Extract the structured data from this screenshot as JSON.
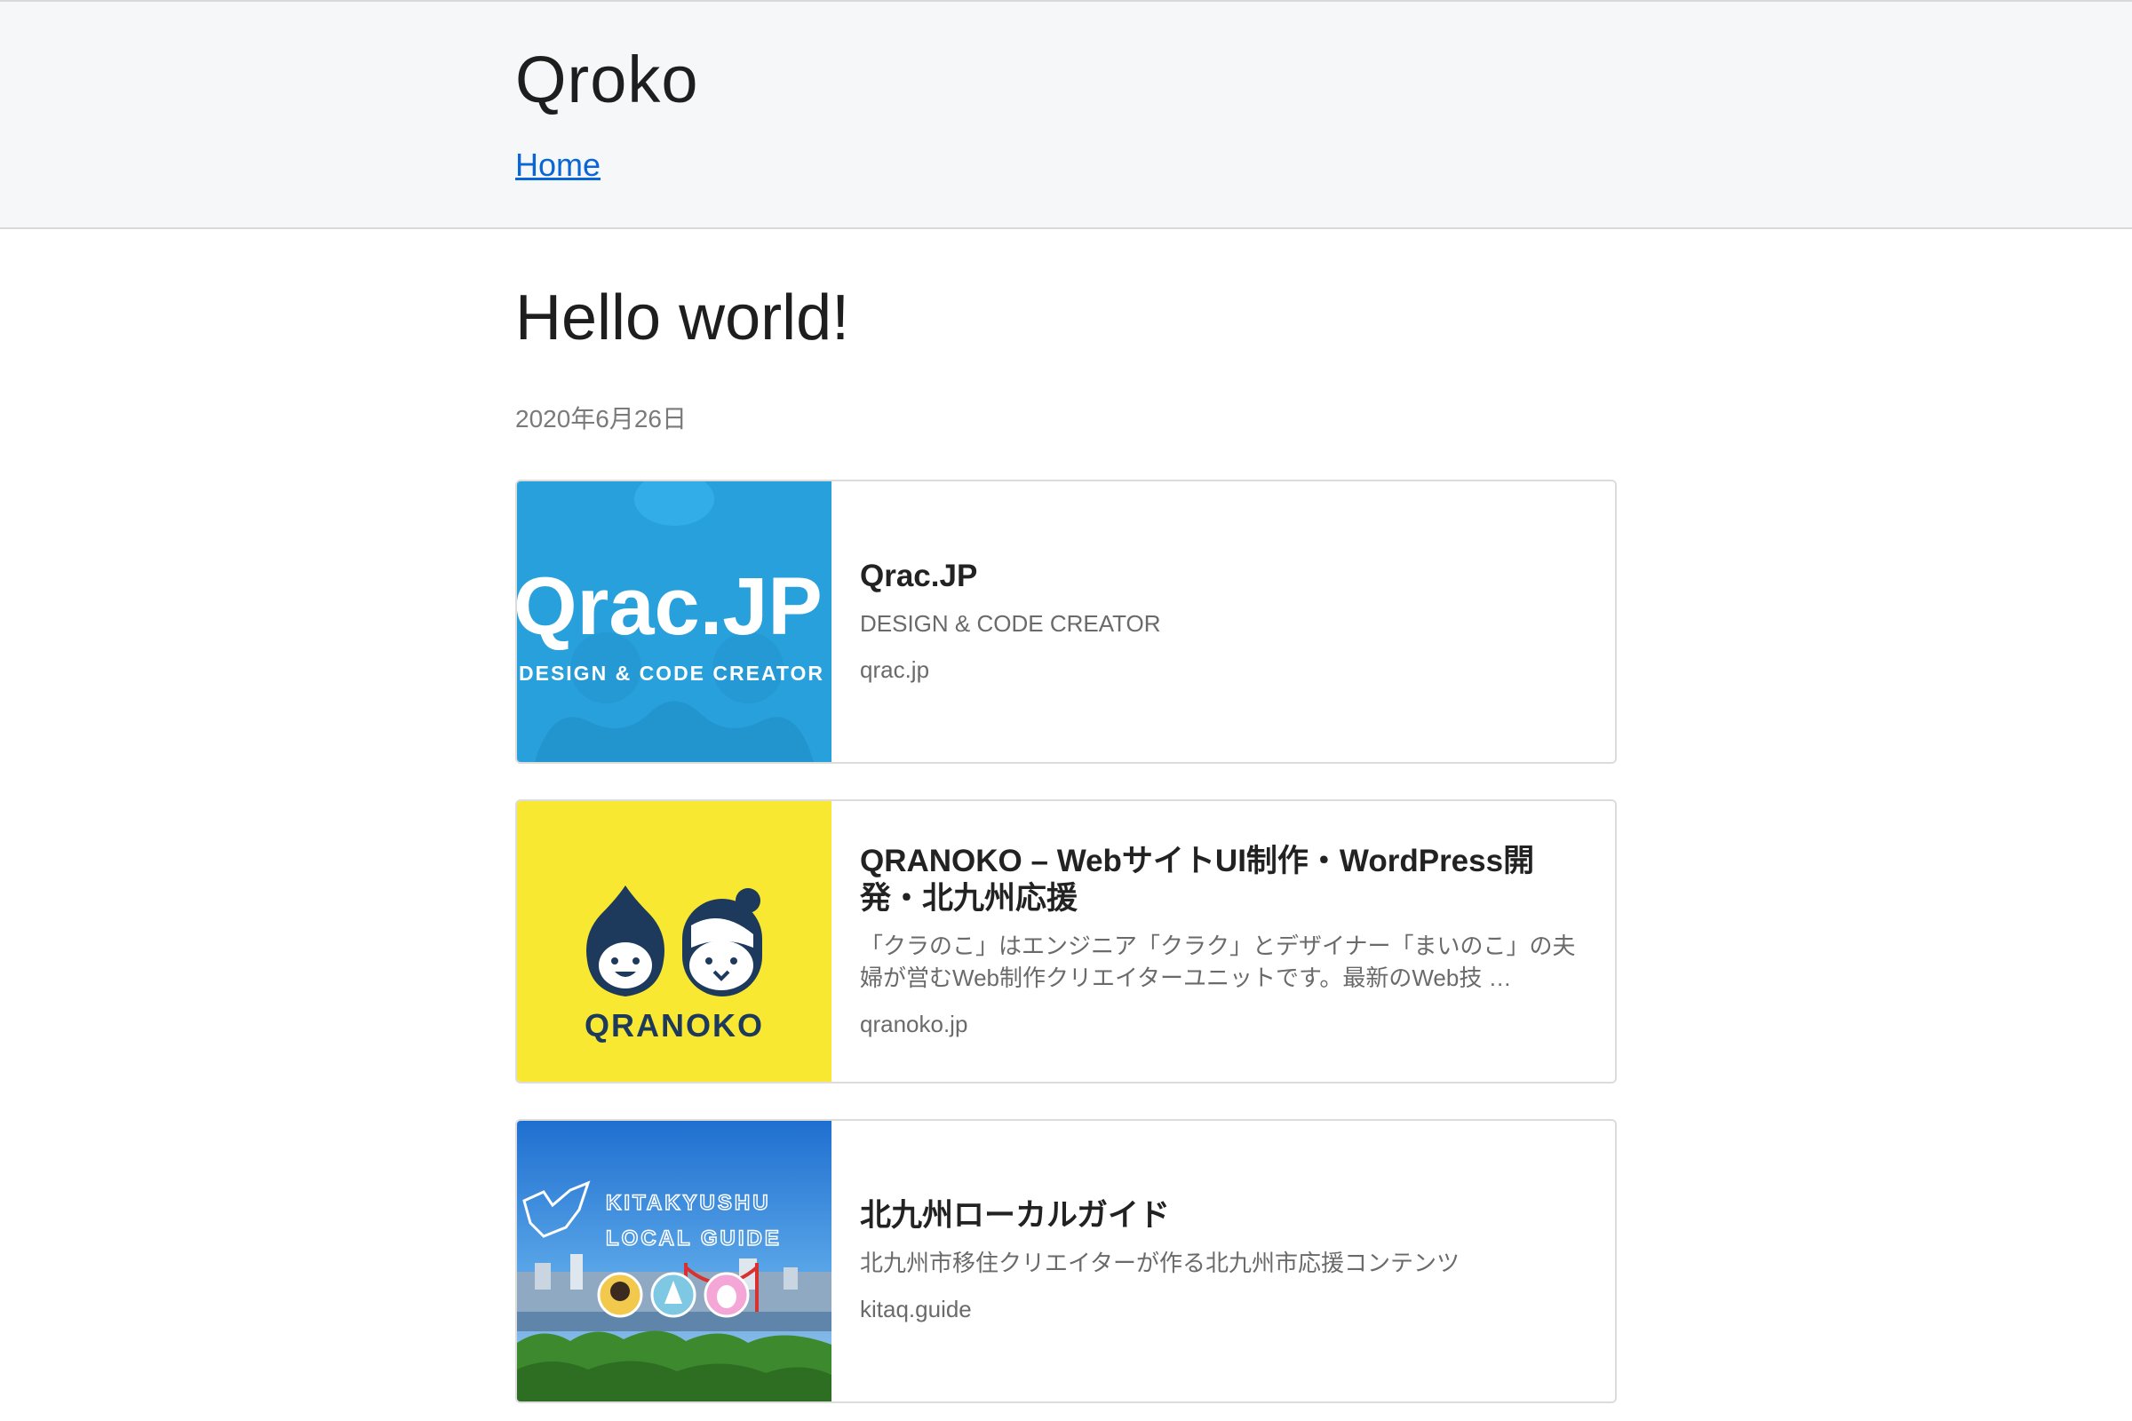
{
  "header": {
    "site_title": "Qroko",
    "nav_home": "Home"
  },
  "post": {
    "title": "Hello world!",
    "date": "2020年6月26日"
  },
  "cards": [
    {
      "title": "Qrac.JP",
      "description": "DESIGN & CODE CREATOR",
      "url": "qrac.jp",
      "thumb_logo": "Qrac.JP",
      "thumb_tagline": "DESIGN & CODE CREATOR",
      "thumb_bg": "#28a0dc"
    },
    {
      "title": "QRANOKO – WebサイトUI制作・WordPress開発・北九州応援",
      "description": "「クラのこ」はエンジニア「クラク」とデザイナー「まいのこ」の夫婦が営むWeb制作クリエイターユニットです。最新のWeb技 …",
      "url": "qranoko.jp",
      "thumb_logo": "QRANOKO",
      "thumb_bg": "#f9e832"
    },
    {
      "title": "北九州ローカルガイド",
      "description": "北九州市移住クリエイターが作る北九州市応援コンテンツ",
      "url": "kitaq.guide",
      "thumb_line1": "KITAKYUSHU",
      "thumb_line2": "LOCAL GUIDE",
      "thumb_bg": "#2f7fd6"
    }
  ],
  "colors": {
    "header_bg": "#f6f7f8",
    "link": "#0a66d6",
    "muted": "#7a7a7a"
  }
}
